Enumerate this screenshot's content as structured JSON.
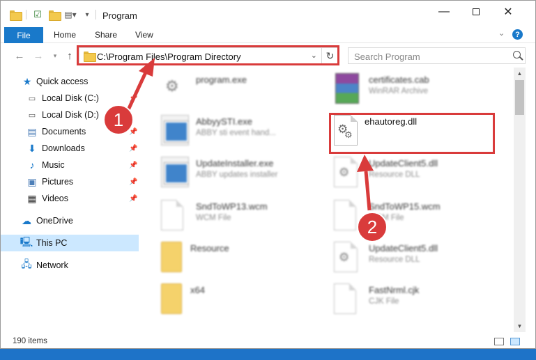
{
  "window": {
    "title": "Program"
  },
  "ribbon": {
    "file": "File",
    "home": "Home",
    "share": "Share",
    "view": "View"
  },
  "address": {
    "path": "C:\\Program Files\\Program Directory"
  },
  "search": {
    "placeholder": "Search Program"
  },
  "sidebar": {
    "items": [
      {
        "label": "Quick access"
      },
      {
        "label": "Local Disk (C:)"
      },
      {
        "label": "Local Disk (D:)"
      },
      {
        "label": "Documents"
      },
      {
        "label": "Downloads"
      },
      {
        "label": "Music"
      },
      {
        "label": "Pictures"
      },
      {
        "label": "Videos"
      },
      {
        "label": "OneDrive"
      },
      {
        "label": "This PC"
      },
      {
        "label": "Network"
      }
    ]
  },
  "files": [
    {
      "name": "program.exe",
      "sub": ""
    },
    {
      "name": "certificates.cab",
      "sub": "WinRAR Archive"
    },
    {
      "name": "AbbyySTI.exe",
      "sub": "ABBY sti event hand..."
    },
    {
      "name": "ehautoreg.dll",
      "sub": ""
    },
    {
      "name": "UpdateInstaller.exe",
      "sub": "ABBY updates installer"
    },
    {
      "name": "UpdateClient5.dll",
      "sub": "Resource DLL"
    },
    {
      "name": "SndToWP13.wcm",
      "sub": "WCM File"
    },
    {
      "name": "SndToWP15.wcm",
      "sub": "WCM File"
    },
    {
      "name": "Resource",
      "sub": ""
    },
    {
      "name": "UpdateClient5.dll",
      "sub": "Resource DLL"
    },
    {
      "name": "x64",
      "sub": ""
    },
    {
      "name": "FastNrml.cjk",
      "sub": "CJK File"
    }
  ],
  "status": {
    "count": "190 items"
  },
  "annotations": {
    "one": "1",
    "two": "2"
  },
  "colors": {
    "accent": "#1979ca",
    "highlight": "#d93b3b",
    "selected": "#cce8ff"
  }
}
